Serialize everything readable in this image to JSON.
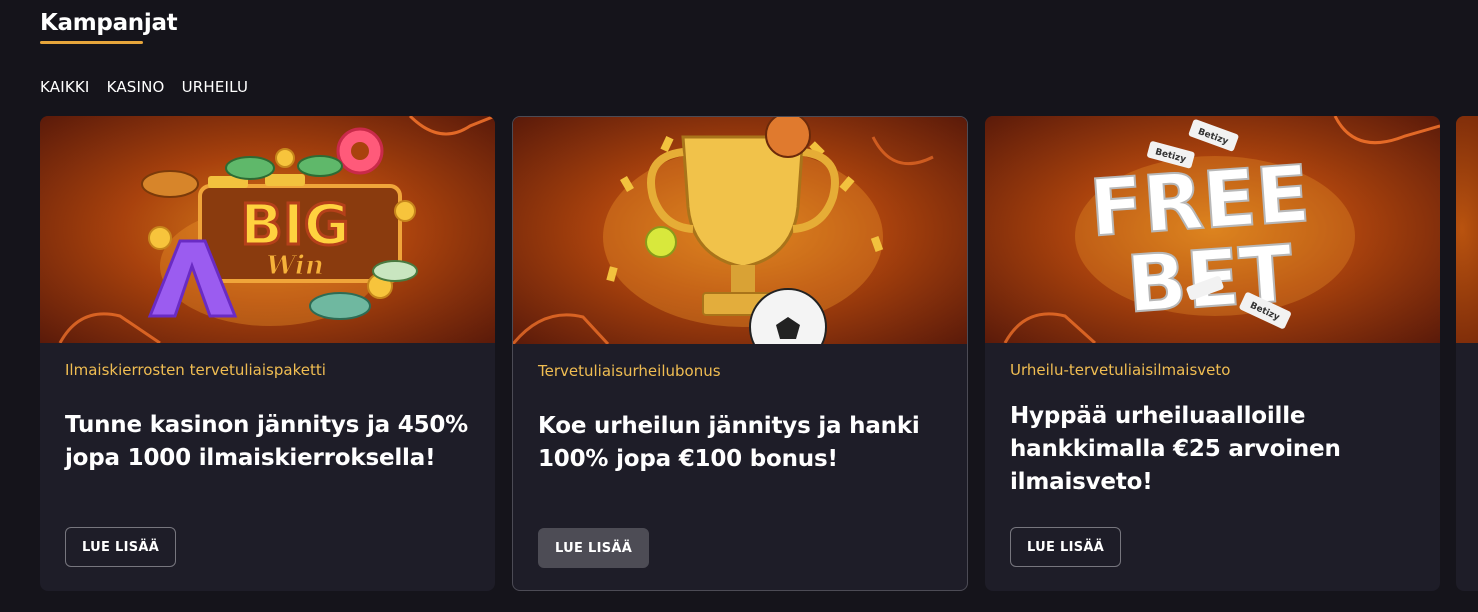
{
  "header": {
    "title": "Kampanjat"
  },
  "filters": [
    {
      "label": "KAIKKI"
    },
    {
      "label": "KASINO"
    },
    {
      "label": "URHEILU"
    }
  ],
  "cards": [
    {
      "category": "Ilmaiskierrosten tervetuliaispaketti",
      "headline": "Tunne kasinon jännitys ja 450% jopa 1000 ilmaiskierroksella!",
      "button_label": "LUE LISÄÄ",
      "image": {
        "art_text_1": "BIG",
        "art_text_2": "Win"
      }
    },
    {
      "category": "Tervetuliaisurheilubonus",
      "headline": "Koe urheilun jännitys ja hanki 100% jopa €100 bonus!",
      "button_label": "LUE LISÄÄ",
      "image": {}
    },
    {
      "category": "Urheilu-tervetuliaisilmaisveto",
      "headline": "Hyppää urheiluaalloille hankkimalla €25 arvoinen ilmaisveto!",
      "button_label": "LUE LISÄÄ",
      "image": {
        "art_text_1": "FREE",
        "art_text_2": "BET",
        "brand": "Betizy"
      }
    }
  ],
  "colors": {
    "background": "#15141b",
    "card": "#1e1d28",
    "accent": "#e6a53b",
    "category": "#f0bd52"
  }
}
